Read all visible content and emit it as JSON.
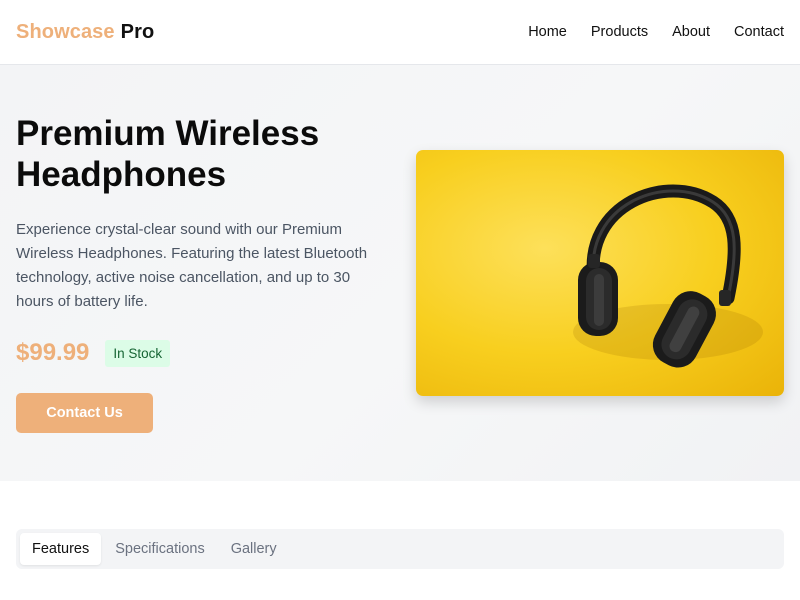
{
  "brand": {
    "part1": "Showcase",
    "part2": "Pro"
  },
  "nav": {
    "items": [
      "Home",
      "Products",
      "About",
      "Contact"
    ]
  },
  "hero": {
    "title": "Premium Wireless Headphones",
    "description": "Experience crystal-clear sound with our Premium Wireless Headphones. Featuring the latest Bluetooth technology, active noise cancellation, and up to 30 hours of battery life.",
    "price": "$99.99",
    "stock_badge": "In Stock",
    "cta_label": "Contact Us"
  },
  "tabs": {
    "items": [
      "Features",
      "Specifications",
      "Gallery"
    ],
    "active": "Features"
  },
  "colors": {
    "accent": "#eeb07a",
    "badge_bg": "#dcfce7",
    "badge_text": "#166534",
    "image_bg": "#f8cf1f"
  }
}
